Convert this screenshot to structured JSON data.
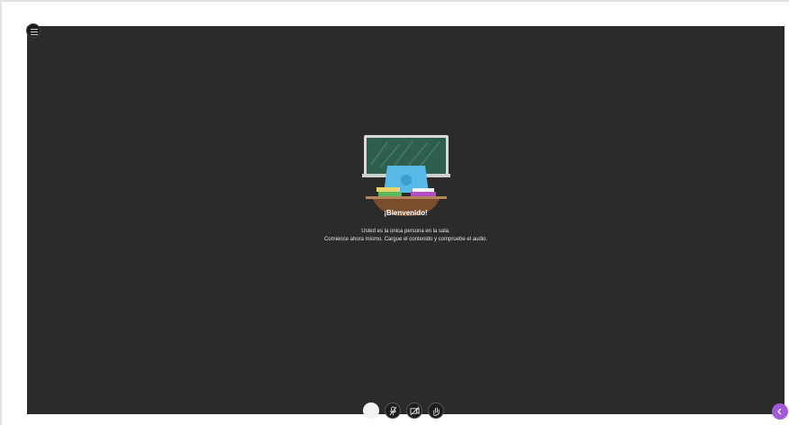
{
  "welcome": {
    "title": "¡Bienvenido!",
    "line1": "Usted es la única persona en la sala.",
    "line2": "Comience ahora mismo. Cargue el contenido y compruebe el audio."
  },
  "icons": {
    "menu": "hamburger-menu-icon",
    "illustration": "classroom-illustration",
    "avatar": "user-avatar-icon",
    "mic": "microphone-muted-icon",
    "camera": "camera-off-icon",
    "hand": "raise-hand-icon",
    "panel": "collaborate-panel-icon"
  },
  "colors": {
    "stage": "#2b2b2b",
    "accent": "#a45ad6",
    "board": "#2e5e4e"
  }
}
